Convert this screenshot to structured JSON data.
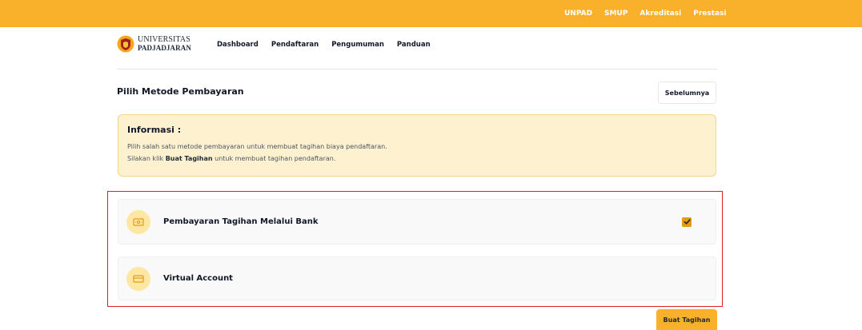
{
  "topbar": {
    "links": [
      "UNPAD",
      "SMUP",
      "Akreditasi",
      "Prestasi"
    ],
    "background": "#f9b02a"
  },
  "navbar": {
    "logo_line1": "UNIVERSITAS",
    "logo_line2": "PADJADJARAN",
    "menu": [
      "Dashboard",
      "Pendaftaran",
      "Pengumuman",
      "Panduan"
    ]
  },
  "page": {
    "title": "Pilih Metode Pembayaran",
    "prev_button": "Sebelumnya"
  },
  "info": {
    "title": "Informasi :",
    "line1": "Pilih salah satu metode pembayaran untuk membuat tagihan biaya pendaftaran.",
    "line2_prefix": "Silakan klik ",
    "line2_bold": "Buat Tagihan",
    "line2_suffix": " untuk membuat tagihan pendaftaran."
  },
  "options": [
    {
      "label": "Pembayaran Tagihan Melalui Bank",
      "icon": "bank-note-icon",
      "checked": true
    },
    {
      "label": "Virtual Account",
      "icon": "credit-card-icon",
      "checked": false
    }
  ],
  "actions": {
    "create_button": "Buat Tagihan"
  },
  "colors": {
    "accent": "#f9b02a",
    "info_bg": "#fdf1cf",
    "highlight": "#e11d2a",
    "check": "#e39b12"
  }
}
